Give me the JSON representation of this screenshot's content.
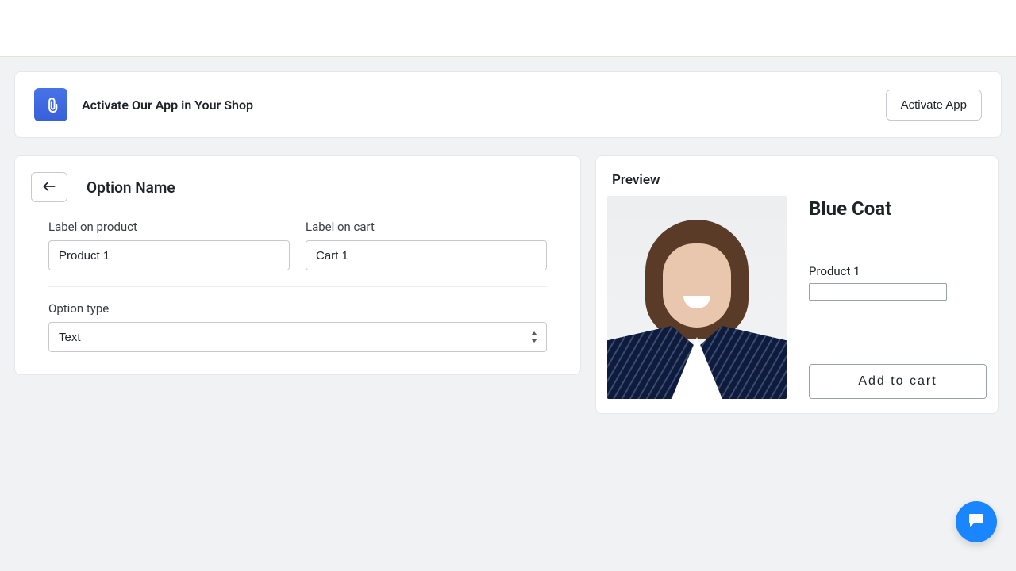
{
  "banner": {
    "title": "Activate Our App in Your Shop",
    "activate_label": "Activate App"
  },
  "editor": {
    "title": "Option Name",
    "label_product_caption": "Label on product",
    "label_product_value": "Product 1",
    "label_cart_caption": "Label on cart",
    "label_cart_value": "Cart 1",
    "option_type_caption": "Option type",
    "option_type_value": "Text"
  },
  "preview": {
    "heading": "Preview",
    "product_title": "Blue Coat",
    "option_label": "Product 1",
    "option_value": "",
    "add_to_cart_label": "Add to cart"
  }
}
